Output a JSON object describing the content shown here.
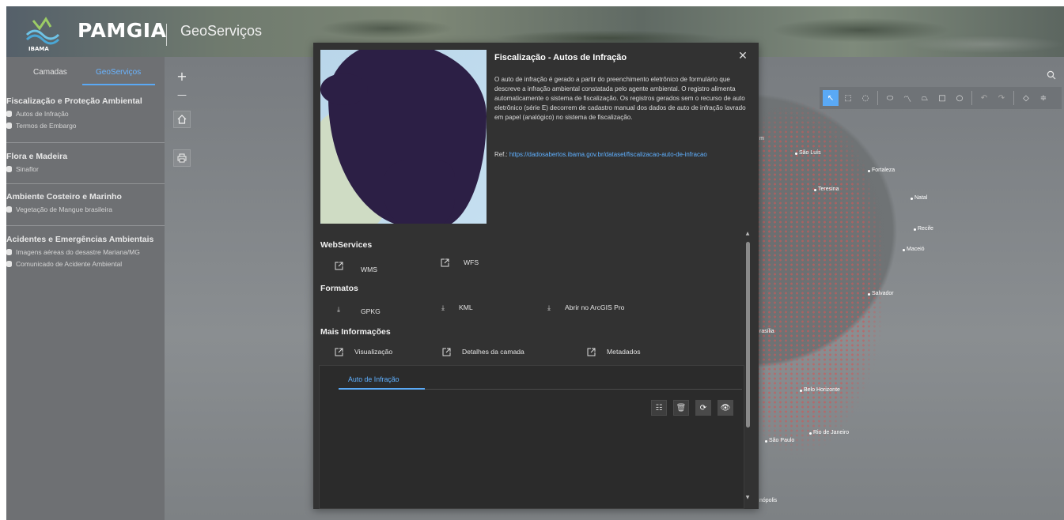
{
  "header": {
    "brand": "PAMGIA",
    "brand_sub": "IBAMA",
    "title": "GeoServiços"
  },
  "sidebar": {
    "tabs": [
      {
        "label": "Camadas",
        "active": false
      },
      {
        "label": "GeoServiços",
        "active": true
      }
    ],
    "sections": [
      {
        "title": "Fiscalização e Proteção Ambiental",
        "layers": [
          "Autos de Infração",
          "Termos de Embargo"
        ]
      },
      {
        "title": "Flora e Madeira",
        "layers": [
          "Sinaflor"
        ]
      },
      {
        "title": "Ambiente Costeiro e Marinho",
        "layers": [
          "Vegetação de Mangue brasileira"
        ]
      },
      {
        "title": "Acidentes e Emergências Ambientais",
        "layers": [
          "Imagens aéreas do desastre Mariana/MG",
          "Comunicado de Acidente Ambiental"
        ]
      }
    ]
  },
  "map": {
    "tools": {
      "zoom_in": "+",
      "zoom_out": "—",
      "home": "home-icon",
      "print": "print-icon"
    },
    "cities": [
      "São Luís",
      "Fortaleza",
      "Teresina",
      "Natal",
      "Recife",
      "Maceió",
      "Salvador",
      "rasília",
      "Belo Horizonte",
      "Rio de Janeiro",
      "São Paulo",
      "nópolis",
      "m"
    ]
  },
  "modal": {
    "title": "Fiscalização - Autos de Infração",
    "description": "O auto de  infração é gerado a partir do preenchimento eletrônico de formulário que  descreve a infração ambiental constatada pelo agente ambiental. O  registro alimenta automaticamente o sistema de fiscalização. Os  registros gerados sem o recurso de auto eletrônico (série E) decorrem de cadastro manual dos dados de auto de infração lavrado em papel (analógico) no sistema de fiscalização.",
    "ref_label": "Ref.:",
    "ref_url": "https://dadosabertos.ibama.gov.br/dataset/fiscalizacao-auto-de-infracao",
    "webservices": {
      "title": "WebServices",
      "items": [
        "WMS",
        "WFS"
      ]
    },
    "formatos": {
      "title": "Formatos",
      "items": [
        "GPKG",
        "KML",
        "Abrir no ArcGIS Pro"
      ]
    },
    "mais": {
      "title": "Mais Informações",
      "items": [
        "Visualização",
        "Detalhes da camada",
        "Metadados"
      ]
    },
    "table_tab": "Auto de Infração"
  },
  "colors": {
    "accent": "#5aa9f5",
    "modal_bg": "#323232",
    "sidebar_bg": "#6e7073"
  }
}
